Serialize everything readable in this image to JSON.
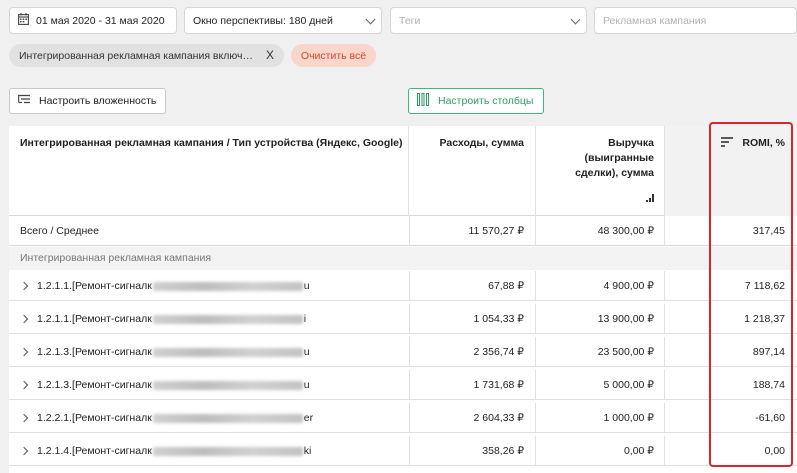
{
  "filters": {
    "date_range": "01 мая 2020 - 31 мая 2020",
    "window_label": "Окно перспективы:",
    "window_value": "180 дней",
    "tags_placeholder": "Теги",
    "campaign_placeholder": "Рекламная кампания"
  },
  "chips": {
    "active_filter": "Интегрированная рекламная кампания включ…",
    "remove": "X",
    "clear_all": "Очистить всё"
  },
  "toolbar": {
    "nesting_label": "Настроить вложенность",
    "columns_label": "Настроить столбцы"
  },
  "table": {
    "headers": {
      "name": "Интегрированная рекламная кампания / Тип устройства (Яндекс, Google)",
      "expenses": "Расходы, сумма",
      "revenue_l1": "Выручка",
      "revenue_l2": "(выигранные",
      "revenue_l3": "сделки), сумма",
      "romi": "ROMI, %"
    },
    "total": {
      "name": "Всего / Среднее",
      "expenses": "11 570,27 ₽",
      "revenue": "48 300,00 ₽",
      "romi": "317,45"
    },
    "group_label": "Интегрированная рекламная кампания",
    "rows": [
      {
        "prefix": "1.2.1.1.[Ремонт-сигналк",
        "suffix": "u",
        "expenses": "67,88 ₽",
        "revenue": "4 900,00 ₽",
        "romi": "7 118,62"
      },
      {
        "prefix": "1.2.1.1.[Ремонт-сигналк",
        "suffix": "i",
        "expenses": "1 054,33 ₽",
        "revenue": "13 900,00 ₽",
        "romi": "1 218,37"
      },
      {
        "prefix": "1.2.1.3.[Ремонт-сигналк",
        "suffix": "u",
        "expenses": "2 356,74 ₽",
        "revenue": "23 500,00 ₽",
        "romi": "897,14"
      },
      {
        "prefix": "1.2.1.3.[Ремонт-сигналк",
        "suffix": "u",
        "expenses": "1 731,68 ₽",
        "revenue": "5 000,00 ₽",
        "romi": "188,74"
      },
      {
        "prefix": "1.2.2.1.[Ремонт-сигналк",
        "suffix": "er",
        "expenses": "2 604,33 ₽",
        "revenue": "1 000,00 ₽",
        "romi": "-61,60"
      },
      {
        "prefix": "1.2.1.4.[Ремонт-сигналк",
        "suffix": "ki",
        "expenses": "358,26 ₽",
        "revenue": "0,00 ₽",
        "romi": "0,00"
      }
    ]
  },
  "colors": {
    "accent_green": "#3dba78",
    "clear_red": "#d2482c",
    "highlight_red": "#d9262a"
  }
}
